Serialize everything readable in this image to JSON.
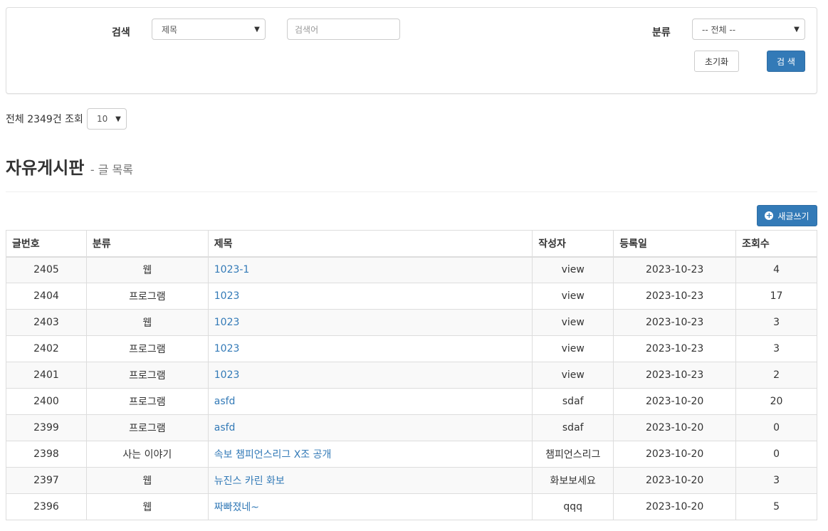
{
  "search": {
    "label": "검색",
    "field_selected": "제목",
    "keyword_placeholder": "검색어",
    "category_label": "분류",
    "category_selected": "-- 전체 --",
    "reset_label": "초기화",
    "submit_label": "검 색"
  },
  "summary": {
    "total_text": "전체 2349건 조회",
    "page_size": "10"
  },
  "page": {
    "title": "자유게시판",
    "subtitle": "- 글 목록",
    "write_label": "새글쓰기"
  },
  "table": {
    "headers": [
      "글번호",
      "분류",
      "제목",
      "작성자",
      "등록일",
      "조회수"
    ],
    "rows": [
      {
        "no": "2405",
        "category": "웹",
        "title": "1023-1",
        "author": "view",
        "date": "2023-10-23",
        "views": "4"
      },
      {
        "no": "2404",
        "category": "프로그램",
        "title": "1023",
        "author": "view",
        "date": "2023-10-23",
        "views": "17"
      },
      {
        "no": "2403",
        "category": "웹",
        "title": "1023",
        "author": "view",
        "date": "2023-10-23",
        "views": "3"
      },
      {
        "no": "2402",
        "category": "프로그램",
        "title": "1023",
        "author": "view",
        "date": "2023-10-23",
        "views": "3"
      },
      {
        "no": "2401",
        "category": "프로그램",
        "title": "1023",
        "author": "view",
        "date": "2023-10-23",
        "views": "2"
      },
      {
        "no": "2400",
        "category": "프로그램",
        "title": "asfd",
        "author": "sdaf",
        "date": "2023-10-20",
        "views": "20"
      },
      {
        "no": "2399",
        "category": "프로그램",
        "title": "asfd",
        "author": "sdaf",
        "date": "2023-10-20",
        "views": "0"
      },
      {
        "no": "2398",
        "category": "사는 이야기",
        "title": "속보 챔피언스리그 X조 공개",
        "author": "챔피언스리그",
        "date": "2023-10-20",
        "views": "0"
      },
      {
        "no": "2397",
        "category": "웹",
        "title": "뉴진스 카린 화보",
        "author": "화보보세요",
        "date": "2023-10-20",
        "views": "3"
      },
      {
        "no": "2396",
        "category": "웹",
        "title": "짜빠졌네~",
        "author": "qqq",
        "date": "2023-10-20",
        "views": "5"
      }
    ]
  },
  "colors": {
    "primary": "#337ab7",
    "link": "#337ab7",
    "border": "#dddddd",
    "stripe": "#f9f9f9"
  },
  "icons": {
    "select_caret": "chevron-down-icon",
    "write_button": "plus-circle-icon"
  }
}
